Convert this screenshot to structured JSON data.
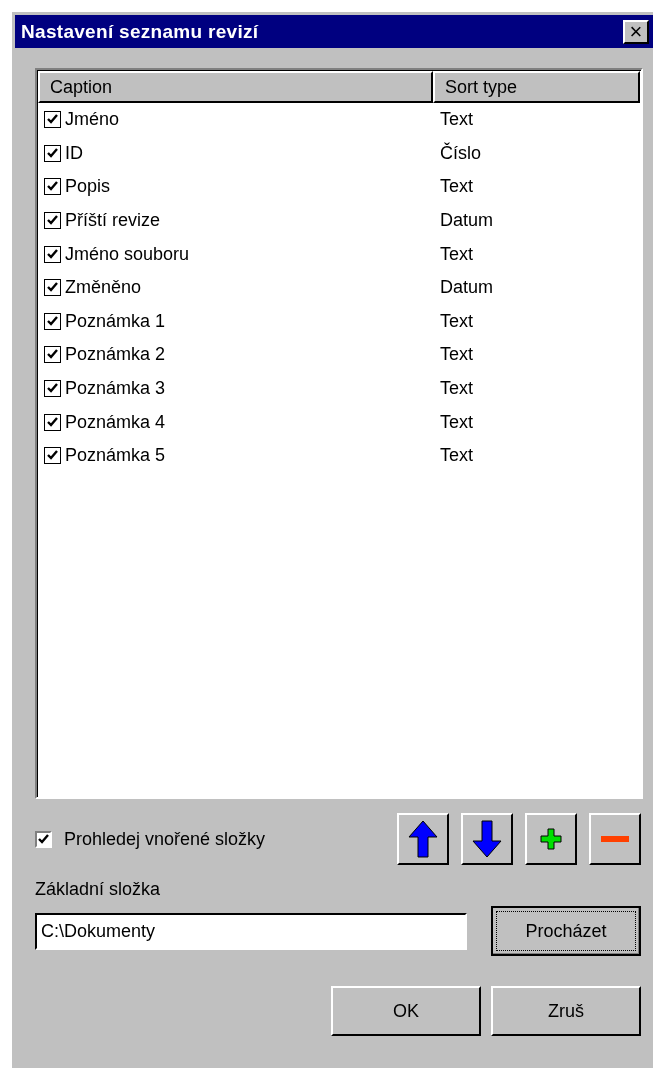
{
  "window": {
    "title": "Nastavení seznamu revizí",
    "close": "×"
  },
  "table": {
    "columns": [
      "Caption",
      "Sort type"
    ],
    "rows": [
      {
        "caption": "Jméno",
        "sort_type": "Text",
        "checked": true
      },
      {
        "caption": "ID",
        "sort_type": "Číslo",
        "checked": true
      },
      {
        "caption": "Popis",
        "sort_type": "Text",
        "checked": true
      },
      {
        "caption": "Příští revize",
        "sort_type": "Datum",
        "checked": true
      },
      {
        "caption": "Jméno souboru",
        "sort_type": "Text",
        "checked": true
      },
      {
        "caption": "Změněno",
        "sort_type": "Datum",
        "checked": true
      },
      {
        "caption": "Poznámka 1",
        "sort_type": "Text",
        "checked": true
      },
      {
        "caption": "Poznámka 2",
        "sort_type": "Text",
        "checked": true
      },
      {
        "caption": "Poznámka 3",
        "sort_type": "Text",
        "checked": true
      },
      {
        "caption": "Poznámka 4",
        "sort_type": "Text",
        "checked": true
      },
      {
        "caption": "Poznámka 5",
        "sort_type": "Text",
        "checked": true
      }
    ]
  },
  "subfolders": {
    "label": "Prohledej vnořené složky",
    "checked": true
  },
  "tool_buttons": [
    {
      "kind": "up"
    },
    {
      "kind": "down"
    },
    {
      "kind": "add"
    },
    {
      "kind": "remove"
    }
  ],
  "base_folder": {
    "label": "Základní složka",
    "value": "C:\\Dokumenty",
    "browse": "Procházet"
  },
  "buttons": [
    "OK",
    "Zruš"
  ]
}
